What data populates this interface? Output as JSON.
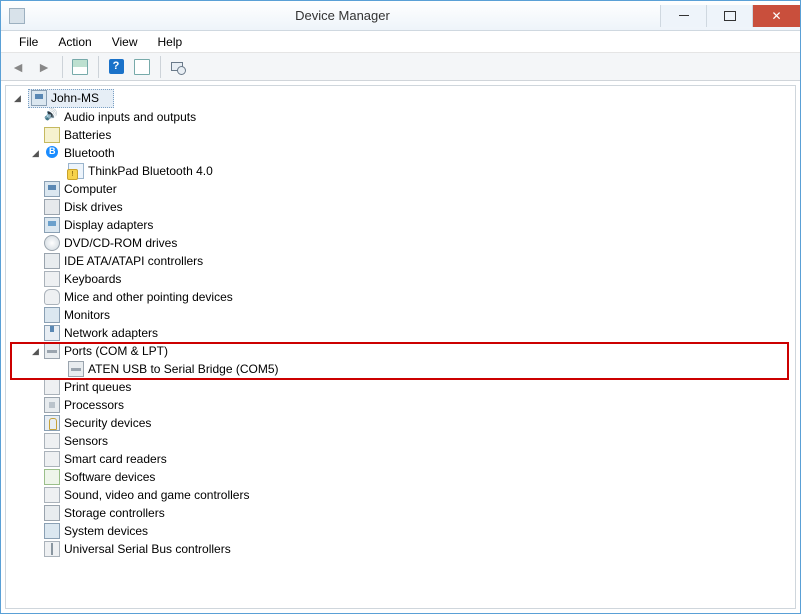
{
  "window": {
    "title": "Device Manager"
  },
  "menubar": [
    "File",
    "Action",
    "View",
    "Help"
  ],
  "toolbar": {
    "back": "back-arrow-icon",
    "forward": "forward-arrow-icon",
    "show_hidden": "show-hidden-icon",
    "help": "?",
    "properties": "properties-icon",
    "scan": "scan-hardware-icon"
  },
  "tree": {
    "root": {
      "label": "John-MS",
      "icon": "computer",
      "expanded": true
    },
    "children": [
      {
        "label": "Audio inputs and outputs",
        "icon": "audio",
        "expanded": false
      },
      {
        "label": "Batteries",
        "icon": "battery",
        "expanded": false
      },
      {
        "label": "Bluetooth",
        "icon": "bt",
        "expanded": true,
        "children": [
          {
            "label": "ThinkPad Bluetooth 4.0",
            "icon": "btdev"
          }
        ]
      },
      {
        "label": "Computer",
        "icon": "computer",
        "expanded": false
      },
      {
        "label": "Disk drives",
        "icon": "disk",
        "expanded": false
      },
      {
        "label": "Display adapters",
        "icon": "display",
        "expanded": false
      },
      {
        "label": "DVD/CD-ROM drives",
        "icon": "dvd",
        "expanded": false
      },
      {
        "label": "IDE ATA/ATAPI controllers",
        "icon": "ide",
        "expanded": false
      },
      {
        "label": "Keyboards",
        "icon": "kb",
        "expanded": false
      },
      {
        "label": "Mice and other pointing devices",
        "icon": "mouse",
        "expanded": false
      },
      {
        "label": "Monitors",
        "icon": "monitor",
        "expanded": false
      },
      {
        "label": "Network adapters",
        "icon": "net",
        "expanded": false
      },
      {
        "label": "Ports (COM & LPT)",
        "icon": "port",
        "expanded": true,
        "highlighted": true,
        "children": [
          {
            "label": "ATEN USB to Serial Bridge (COM5)",
            "icon": "port"
          }
        ]
      },
      {
        "label": "Print queues",
        "icon": "print",
        "expanded": false
      },
      {
        "label": "Processors",
        "icon": "cpu",
        "expanded": false
      },
      {
        "label": "Security devices",
        "icon": "sec",
        "expanded": false
      },
      {
        "label": "Sensors",
        "icon": "sensor",
        "expanded": false
      },
      {
        "label": "Smart card readers",
        "icon": "card",
        "expanded": false
      },
      {
        "label": "Software devices",
        "icon": "soft",
        "expanded": false
      },
      {
        "label": "Sound, video and game controllers",
        "icon": "sound",
        "expanded": false
      },
      {
        "label": "Storage controllers",
        "icon": "storage",
        "expanded": false
      },
      {
        "label": "System devices",
        "icon": "sys",
        "expanded": false
      },
      {
        "label": "Universal Serial Bus controllers",
        "icon": "usb",
        "expanded": false
      }
    ]
  }
}
